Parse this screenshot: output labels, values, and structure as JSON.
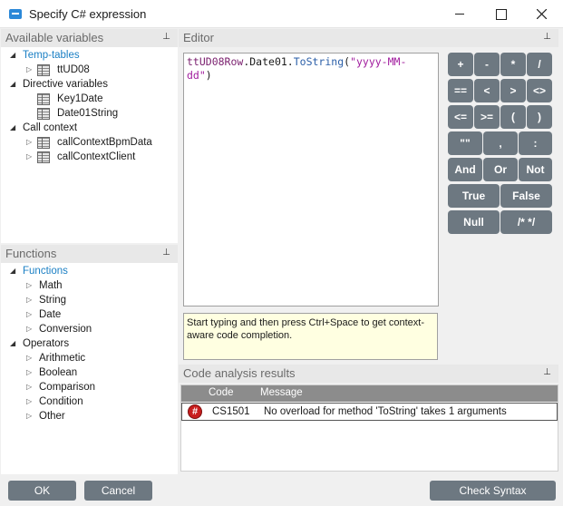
{
  "window": {
    "title": "Specify C# expression"
  },
  "panels": {
    "variables": "Available variables",
    "editor": "Editor",
    "functions": "Functions",
    "analysis": "Code analysis results",
    "pin_glyph": "⊥"
  },
  "variables": {
    "temp_tables": "Temp-tables",
    "ttUD08": "ttUD08",
    "directive_variables": "Directive variables",
    "key1date": "Key1Date",
    "date01string": "Date01String",
    "call_context": "Call context",
    "bpm_data": "callContextBpmData",
    "client": "callContextClient"
  },
  "functions": {
    "functions": "Functions",
    "math": "Math",
    "string": "String",
    "date": "Date",
    "conversion": "Conversion",
    "operators": "Operators",
    "arithmetic": "Arithmetic",
    "boolean": "Boolean",
    "comparison": "Comparison",
    "condition": "Condition",
    "other": "Other"
  },
  "editor": {
    "code_id": "ttUD08Row",
    "code_dot1": ".",
    "code_prop": "Date01",
    "code_dot2": ".",
    "code_method": "ToString",
    "code_open": "(",
    "code_string1": "\"yyyy-MM-",
    "code_string2": "dd\"",
    "code_close": ")",
    "hint": "Start typing and then press Ctrl+Space to get context-aware code completion."
  },
  "keys": {
    "plus": "+",
    "minus": "-",
    "multiply": "*",
    "divide": "/",
    "eq": "==",
    "lt": "<",
    "gt": ">",
    "neq": "<>",
    "le": "<=",
    "ge": ">=",
    "lparen": "(",
    "rparen": ")",
    "quotes": "\"\"",
    "comma": ",",
    "colon": ":",
    "and": "And",
    "or": "Or",
    "not": "Not",
    "true": "True",
    "false": "False",
    "null": "Null",
    "comment": "/* */"
  },
  "analysis": {
    "col_code": "Code",
    "col_message": "Message",
    "rows": [
      {
        "icon": "#",
        "code": "CS1501",
        "message": "No overload for method 'ToString' takes 1 arguments"
      }
    ]
  },
  "buttons": {
    "ok": "OK",
    "cancel": "Cancel",
    "check_syntax": "Check Syntax"
  }
}
